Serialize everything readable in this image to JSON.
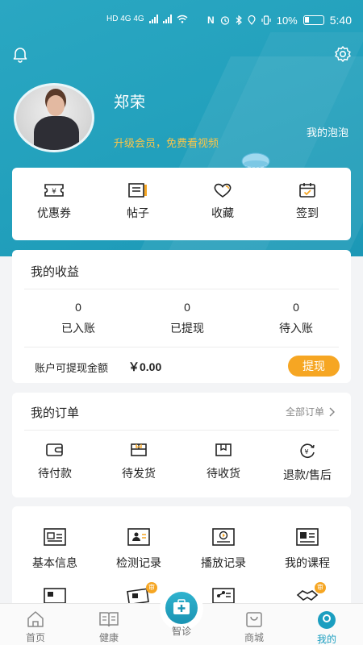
{
  "status_bar": {
    "network_left": "HD 4G 4G",
    "nfc": "N",
    "battery_percent": "10%",
    "time": "5:40"
  },
  "profile": {
    "name": "郑荣",
    "upgrade_text": "升级会员，免费看视频",
    "bubble_link": "我的泡泡"
  },
  "quick_actions": [
    {
      "label": "优惠券",
      "icon": "coupon-icon"
    },
    {
      "label": "帖子",
      "icon": "post-icon"
    },
    {
      "label": "收藏",
      "icon": "heart-icon"
    },
    {
      "label": "签到",
      "icon": "calendar-check-icon"
    }
  ],
  "income": {
    "title": "我的收益",
    "stats": [
      {
        "value": "0",
        "label": "已入账"
      },
      {
        "value": "0",
        "label": "已提现"
      },
      {
        "value": "0",
        "label": "待入账"
      }
    ],
    "withdrawable_label": "账户可提现金额",
    "withdrawable_amount": "￥0.00",
    "withdraw_button": "提现"
  },
  "orders": {
    "title": "我的订单",
    "all_link": "全部订单",
    "items": [
      {
        "label": "待付款",
        "icon": "wallet-icon"
      },
      {
        "label": "待发货",
        "icon": "package-icon"
      },
      {
        "label": "待收货",
        "icon": "box-icon"
      },
      {
        "label": "退款/售后",
        "icon": "refund-icon"
      }
    ]
  },
  "tools": {
    "items": [
      {
        "label": "基本信息",
        "icon": "id-card-icon"
      },
      {
        "label": "检测记录",
        "icon": "report-icon"
      },
      {
        "label": "播放记录",
        "icon": "play-history-icon"
      },
      {
        "label": "我的课程",
        "icon": "course-icon"
      }
    ],
    "more_items_badge": "审"
  },
  "tabbar": {
    "tabs": [
      {
        "label": "首页",
        "icon": "home-icon"
      },
      {
        "label": "健康",
        "icon": "book-icon"
      },
      {
        "label": "智诊",
        "icon": "medical-kit-icon"
      },
      {
        "label": "商城",
        "icon": "shop-bag-icon"
      },
      {
        "label": "我的",
        "icon": "profile-icon"
      }
    ],
    "active": "我的"
  },
  "colors": {
    "brand": "#22a0bc",
    "accent": "#f6a623",
    "vip_text": "#f8c54a"
  }
}
